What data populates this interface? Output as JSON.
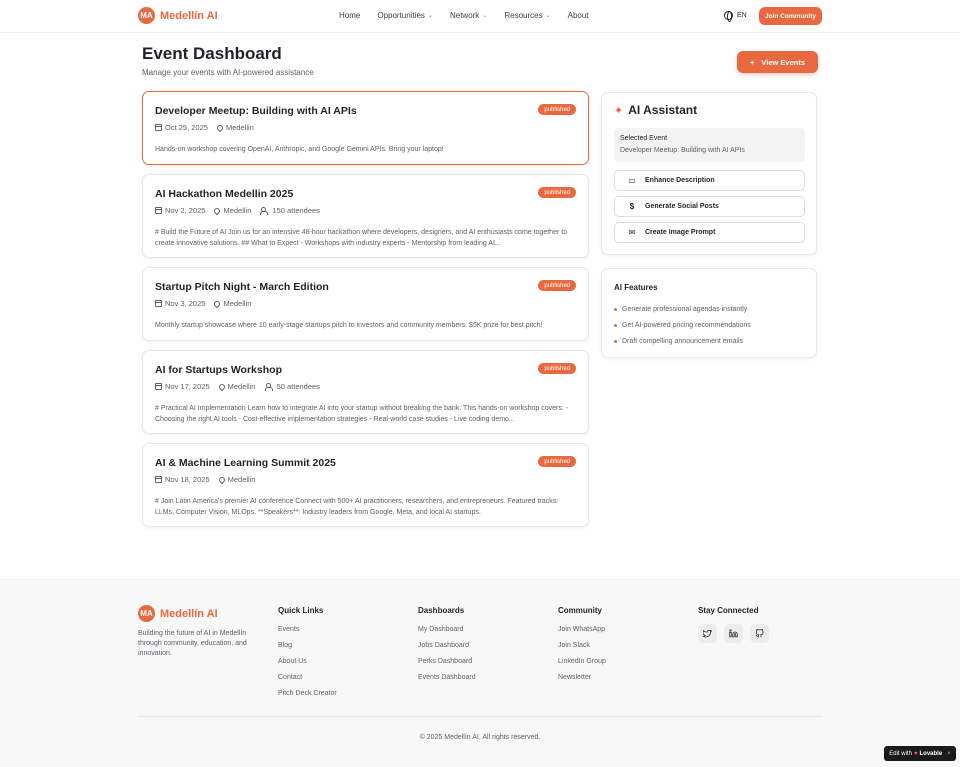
{
  "header": {
    "logo_initials": "MA",
    "logo_text": "Medellín AI",
    "nav": [
      {
        "label": "Home",
        "dropdown": false
      },
      {
        "label": "Opportunities",
        "dropdown": true
      },
      {
        "label": "Network",
        "dropdown": true
      },
      {
        "label": "Resources",
        "dropdown": true
      },
      {
        "label": "About",
        "dropdown": false
      }
    ],
    "language": "EN",
    "join_button": "Join Community"
  },
  "page": {
    "title": "Event Dashboard",
    "subtitle": "Manage your events with AI-powered assistance",
    "view_events_button": "View Events"
  },
  "events": [
    {
      "title": "Developer Meetup: Building with AI APIs",
      "status": "published",
      "date": "Oct 25, 2025",
      "location": "Medellin",
      "attendees": "",
      "description": "Hands-on workshop covering OpenAI, Anthropic, and Google Gemini APIs. Bring your laptop!",
      "selected": true
    },
    {
      "title": "AI Hackathon Medellin 2025",
      "status": "published",
      "date": "Nov 2, 2025",
      "location": "Medellin",
      "attendees": "150 attendees",
      "description": "# Build the Future of AI Join us for an intensive 48-hour hackathon where developers, designers, and AI enthusiasts come together to create innovative solutions. ## What to Expect - Workshops with industry experts - Mentorship from leading AI...",
      "selected": false
    },
    {
      "title": "Startup Pitch Night - March Edition",
      "status": "published",
      "date": "Nov 3, 2025",
      "location": "Medellin",
      "attendees": "",
      "description": "Monthly startup showcase where 10 early-stage startups pitch to investors and community members. $5K prize for best pitch!",
      "selected": false
    },
    {
      "title": "AI for Startups Workshop",
      "status": "published",
      "date": "Nov 17, 2025",
      "location": "Medellin",
      "attendees": "50 attendees",
      "description": "# Practical AI Implementation Learn how to integrate AI into your startup without breaking the bank. This hands-on workshop covers: - Choosing the right AI tools - Cost-effective implementation strategies - Real-world case studies - Live coding demo...",
      "selected": false
    },
    {
      "title": "AI & Machine Learning Summit 2025",
      "status": "published",
      "date": "Nov 18, 2025",
      "location": "Medellin",
      "attendees": "",
      "description": "# Join Latin America's premier AI conference Connect with 500+ AI practitioners, researchers, and entrepreneurs. Featured tracks: LLMs, Computer Vision, MLOps. **Speakers**: Industry leaders from Google, Meta, and local AI startups.",
      "selected": false
    }
  ],
  "assistant": {
    "title": "AI Assistant",
    "selected_label": "Selected Event",
    "selected_value": "Developer Meetup: Building with AI APIs",
    "buttons": [
      {
        "label": "Enhance Description",
        "icon": "calendar-icon"
      },
      {
        "label": "Generate Social Posts",
        "icon": "dollar-icon"
      },
      {
        "label": "Create Image Prompt",
        "icon": "mail-icon"
      }
    ]
  },
  "features": {
    "title": "AI Features",
    "items": [
      "Generate professional agendas instantly",
      "Get AI-powered pricing recommendations",
      "Draft compelling announcement emails"
    ]
  },
  "footer": {
    "logo_initials": "MA",
    "logo_text": "Medellín AI",
    "about": "Building the future of AI in Medellín through community, education, and innovation.",
    "columns": [
      {
        "title": "Quick Links",
        "links": [
          "Events",
          "Blog",
          "About Us",
          "Contact",
          "Pitch Deck Creator"
        ]
      },
      {
        "title": "Dashboards",
        "links": [
          "My Dashboard",
          "Jobs Dashboard",
          "Perks Dashboard",
          "Events Dashboard"
        ]
      },
      {
        "title": "Community",
        "links": [
          "Join WhatsApp",
          "Join Slack",
          "LinkedIn Group",
          "Newsletter"
        ]
      }
    ],
    "stay_connected": "Stay Connected",
    "social": [
      "twitter-icon",
      "linkedin-icon",
      "github-icon"
    ],
    "copyright": "© 2025 Medellín AI. All rights reserved."
  },
  "lovable_badge": {
    "prefix": "Edit with",
    "brand": "Lovable"
  },
  "colors": {
    "accent": "#e8693f",
    "text": "#1f2329",
    "muted": "#5c6068"
  }
}
